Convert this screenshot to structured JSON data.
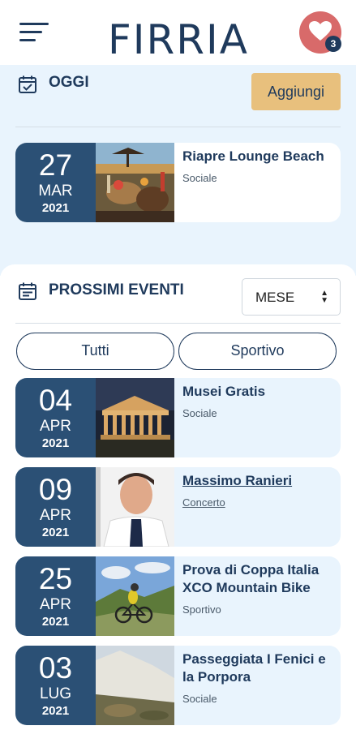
{
  "header": {
    "logo_text": "FIRRIA",
    "favorites_count": "3"
  },
  "today": {
    "title": "OGGI",
    "add_label": "Aggiungi",
    "events": [
      {
        "day": "27",
        "month": "MAR",
        "year": "2021",
        "title": "Riapre Lounge Beach",
        "category": "Sociale"
      }
    ]
  },
  "upcoming": {
    "title": "PROSSIMI EVENTI",
    "period_selected": "MESE",
    "filters": [
      "Tutti",
      "Sportivo"
    ],
    "events": [
      {
        "day": "04",
        "month": "APR",
        "year": "2021",
        "title": "Musei Gratis",
        "category": "Sociale"
      },
      {
        "day": "09",
        "month": "APR",
        "year": "2021",
        "title": "Massimo Ranieri",
        "category": "Concerto"
      },
      {
        "day": "25",
        "month": "APR",
        "year": "2021",
        "title": "Prova di Coppa Italia XCO Mountain Bike",
        "category": "Sportivo"
      },
      {
        "day": "03",
        "month": "LUG",
        "year": "2021",
        "title": "Passeggiata I Fenici e la Porpora",
        "category": "Sociale"
      }
    ]
  },
  "colors": {
    "primary": "#1f3a5c",
    "date_box": "#2b5075",
    "accent": "#e8c07d",
    "favorite": "#d86a6a",
    "section_bg": "#e9f4fd"
  }
}
